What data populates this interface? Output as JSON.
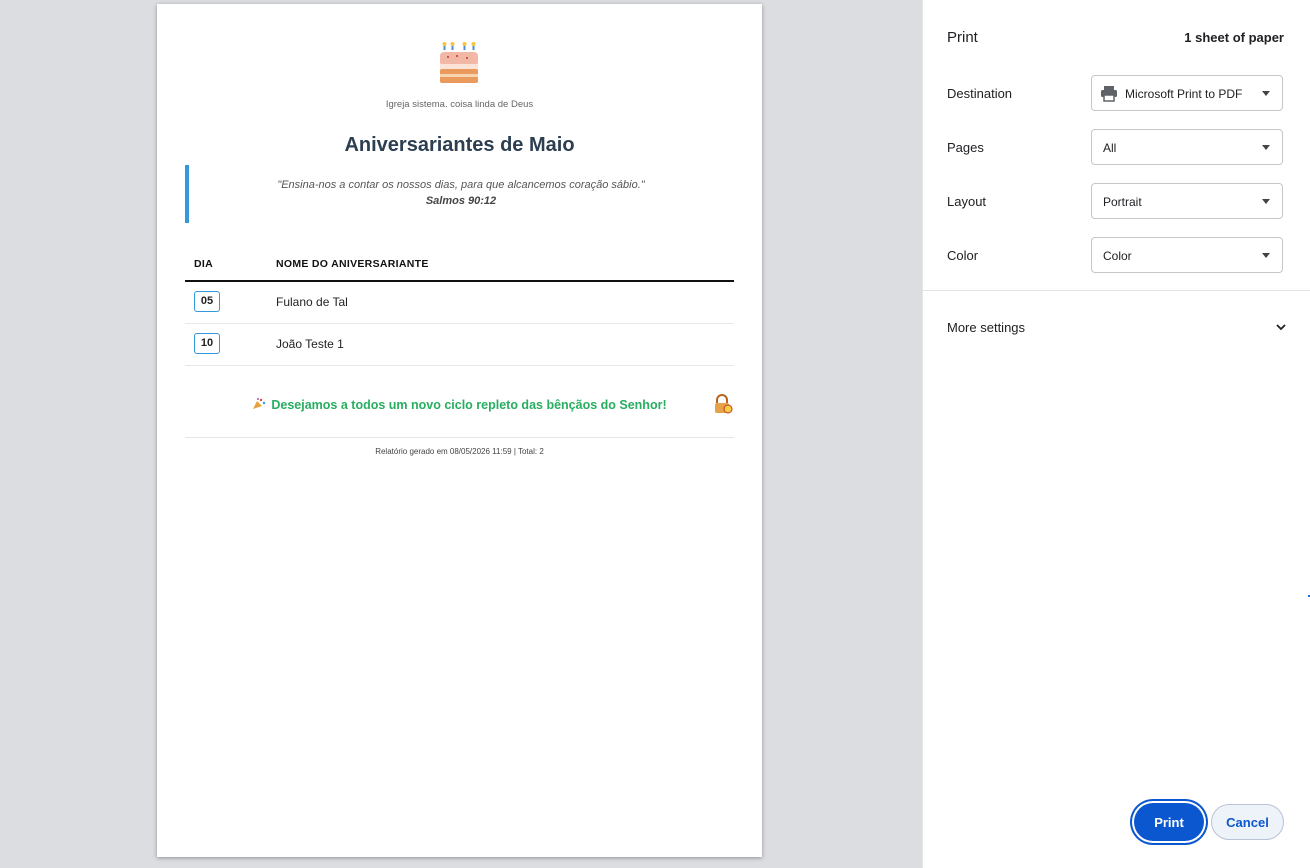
{
  "preview": {
    "church_name": "Igreja sistema. coisa linda de Deus",
    "report_title": "Aniversariantes de Maio",
    "verse": "\"Ensina-nos a contar os nossos dias, para que alcancemos coração sábio.\"",
    "verse_ref": "Salmos 90:12",
    "table": {
      "headers": [
        "DIA",
        "NOME DO ANIVERSARIANTE"
      ],
      "rows": [
        {
          "day": "05",
          "name": "Fulano de Tal"
        },
        {
          "day": "10",
          "name": "João Teste 1"
        }
      ]
    },
    "wish": "Desejamos a todos um novo ciclo repleto das bênçãos do Senhor!",
    "footer": "Relatório gerado em 08/05/2026 11:59 | Total: 2",
    "icons": {
      "header": "birthday-cake-icon",
      "wish": "party-popper-icon",
      "corner": "lock-icon"
    }
  },
  "panel": {
    "title": "Print",
    "sheets": "1 sheet of paper",
    "destination": {
      "label": "Destination",
      "value": "Microsoft Print to PDF",
      "icon": "printer-icon"
    },
    "pages": {
      "label": "Pages",
      "value": "All"
    },
    "layout": {
      "label": "Layout",
      "value": "Portrait"
    },
    "color": {
      "label": "Color",
      "value": "Color"
    },
    "more_settings": "More settings",
    "print_button": "Print",
    "cancel_button": "Cancel"
  },
  "colors": {
    "accent_blue": "#0b57d0",
    "title": "#2c3e50",
    "verse_border": "#3498db",
    "wish_green": "#27ae60"
  }
}
